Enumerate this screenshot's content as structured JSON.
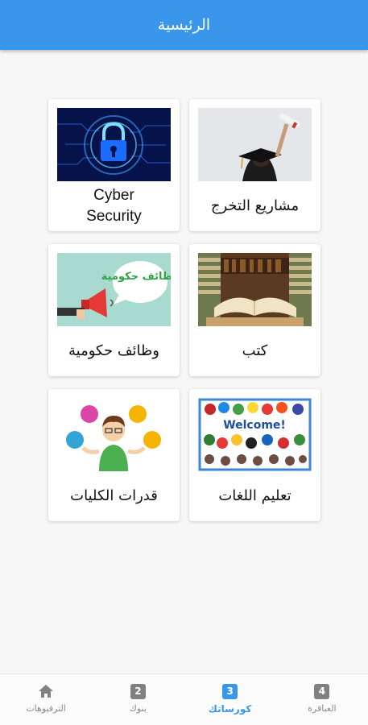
{
  "app_bar": {
    "title": "الرئيسية"
  },
  "cards": [
    {
      "label": "مشاريع التخرج",
      "image": "graduation-cap-photo"
    },
    {
      "label": "Cyber\nSecurity",
      "image": "cyber-lock-photo"
    },
    {
      "label": "كتب",
      "image": "books-photo"
    },
    {
      "label": "وظائف حكومية",
      "image": "megaphone-jobs-illustration",
      "image_text": "وظائف حكومية"
    },
    {
      "label": "تعليم اللغات",
      "image": "language-flags-welcome",
      "image_text": "Welcome!"
    },
    {
      "label": "قدرات الكليات",
      "image": "student-juggling-icons"
    }
  ],
  "bottom_nav": {
    "items": [
      {
        "label": "الترفيوهات",
        "icon": "home-icon"
      },
      {
        "label": "بنوك",
        "icon_text": "2"
      },
      {
        "label": "كورساتك",
        "icon_text": "3",
        "active": true
      },
      {
        "label": "العباقرة",
        "icon_text": "4"
      }
    ]
  },
  "colors": {
    "primary": "#3a96ea",
    "inactive": "#808080",
    "background": "#f7f7f7"
  }
}
